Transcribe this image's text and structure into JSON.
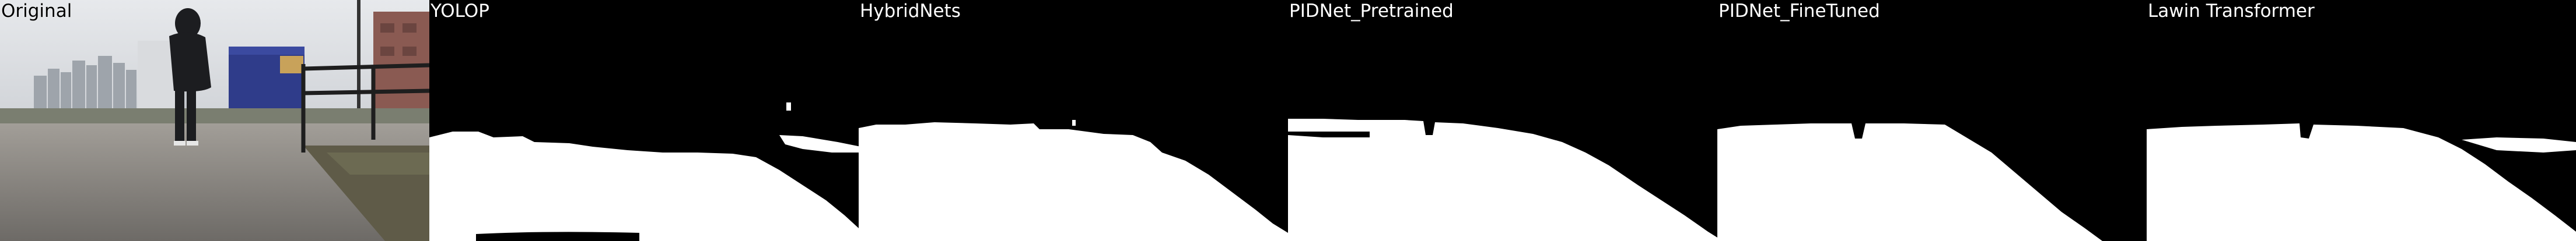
{
  "panels": [
    {
      "title": "Original"
    },
    {
      "title": "YOLOP"
    },
    {
      "title": "HybridNets"
    },
    {
      "title": "PIDNet_Pretrained"
    },
    {
      "title": "PIDNet_FineTuned"
    },
    {
      "title": "Lawin Transformer"
    }
  ],
  "colors": {
    "mask": "#ffffff",
    "background": "#000000",
    "sky": "#c9ccd1",
    "road": "#8d8a85"
  }
}
